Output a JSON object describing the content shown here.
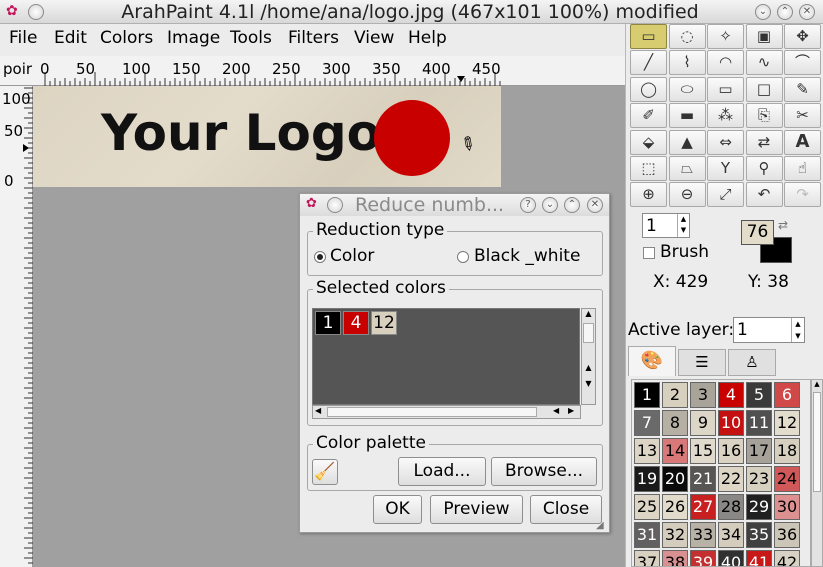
{
  "window": {
    "title": "ArahPaint 4.1l /home/ana/logo.jpg  (467x101  100%) modified"
  },
  "menu": [
    "File",
    "Edit",
    "Colors",
    "Image",
    "Tools",
    "Filters",
    "View",
    "Help"
  ],
  "ruler": {
    "corner_label": "poir",
    "h_ticks": [
      "0",
      "50",
      "100",
      "150",
      "200",
      "250",
      "300",
      "350",
      "400",
      "450"
    ],
    "v_ticks": [
      "100",
      "50",
      "0"
    ]
  },
  "image": {
    "logo_text": "Your Logo",
    "circle_color": "#c80000"
  },
  "dialog": {
    "title": "Reduce numb...",
    "reduction_type": {
      "label": "Reduction type",
      "options": [
        "Color",
        "Black _white"
      ],
      "selected": "Color"
    },
    "selected_colors": {
      "label": "Selected colors",
      "chips": [
        {
          "num": "1",
          "bg": "#000000",
          "fg": "#ffffff"
        },
        {
          "num": "4",
          "bg": "#c80000",
          "fg": "#ffffff"
        },
        {
          "num": "12",
          "bg": "#d8d0be",
          "fg": "#000000"
        }
      ]
    },
    "color_palette": {
      "label": "Color palette",
      "load": "Load...",
      "browse": "Browse..."
    },
    "buttons": {
      "ok": "OK",
      "preview": "Preview",
      "close": "Close"
    }
  },
  "panel": {
    "size_value": "1",
    "brush_label": "Brush",
    "fg_number": "76",
    "x_label": "X: 429",
    "y_label": "Y: 38",
    "active_layer_label": "Active layer:",
    "active_layer_value": "1",
    "palette": [
      {
        "n": "1",
        "bg": "#000000",
        "fg": "#ffffff"
      },
      {
        "n": "2",
        "bg": "#d8d0be",
        "fg": "#000000"
      },
      {
        "n": "3",
        "bg": "#a8a49a",
        "fg": "#000000"
      },
      {
        "n": "4",
        "bg": "#c80000",
        "fg": "#ffffff"
      },
      {
        "n": "5",
        "bg": "#3a3a3a",
        "fg": "#ffffff"
      },
      {
        "n": "6",
        "bg": "#d04848",
        "fg": "#ffffff"
      },
      {
        "n": "7",
        "bg": "#6a6a6a",
        "fg": "#ffffff"
      },
      {
        "n": "8",
        "bg": "#b6b0a4",
        "fg": "#000000"
      },
      {
        "n": "9",
        "bg": "#dcd6c8",
        "fg": "#000000"
      },
      {
        "n": "10",
        "bg": "#c41010",
        "fg": "#ffffff"
      },
      {
        "n": "11",
        "bg": "#505050",
        "fg": "#ffffff"
      },
      {
        "n": "12",
        "bg": "#e2dccd",
        "fg": "#000000"
      },
      {
        "n": "13",
        "bg": "#dcd4c4",
        "fg": "#000000"
      },
      {
        "n": "14",
        "bg": "#d87878",
        "fg": "#000000"
      },
      {
        "n": "15",
        "bg": "#e0dacc",
        "fg": "#000000"
      },
      {
        "n": "16",
        "bg": "#dad2c2",
        "fg": "#000000"
      },
      {
        "n": "17",
        "bg": "#a6a29a",
        "fg": "#000000"
      },
      {
        "n": "18",
        "bg": "#d6cebe",
        "fg": "#000000"
      },
      {
        "n": "19",
        "bg": "#1a1a1a",
        "fg": "#ffffff"
      },
      {
        "n": "20",
        "bg": "#0a0a0a",
        "fg": "#ffffff"
      },
      {
        "n": "21",
        "bg": "#585654",
        "fg": "#ffffff"
      },
      {
        "n": "22",
        "bg": "#ddd6c6",
        "fg": "#000000"
      },
      {
        "n": "23",
        "bg": "#d6d0c0",
        "fg": "#000000"
      },
      {
        "n": "24",
        "bg": "#d05858",
        "fg": "#000000"
      },
      {
        "n": "25",
        "bg": "#dcd5c5",
        "fg": "#000000"
      },
      {
        "n": "26",
        "bg": "#e1dbcc",
        "fg": "#000000"
      },
      {
        "n": "27",
        "bg": "#c82020",
        "fg": "#ffffff"
      },
      {
        "n": "28",
        "bg": "#8a8884",
        "fg": "#000000"
      },
      {
        "n": "29",
        "bg": "#202020",
        "fg": "#ffffff"
      },
      {
        "n": "30",
        "bg": "#dc9090",
        "fg": "#000000"
      },
      {
        "n": "31",
        "bg": "#626060",
        "fg": "#ffffff"
      },
      {
        "n": "32",
        "bg": "#d4ccbc",
        "fg": "#000000"
      },
      {
        "n": "33",
        "bg": "#b8b2a6",
        "fg": "#000000"
      },
      {
        "n": "34",
        "bg": "#d4cdbd",
        "fg": "#000000"
      },
      {
        "n": "35",
        "bg": "#404040",
        "fg": "#ffffff"
      },
      {
        "n": "36",
        "bg": "#ccc6b8",
        "fg": "#000000"
      },
      {
        "n": "37",
        "bg": "#d8d0c0",
        "fg": "#000000"
      },
      {
        "n": "38",
        "bg": "#d89090",
        "fg": "#000000"
      },
      {
        "n": "39",
        "bg": "#c43030",
        "fg": "#ffffff"
      },
      {
        "n": "40",
        "bg": "#303030",
        "fg": "#ffffff"
      },
      {
        "n": "41",
        "bg": "#c81818",
        "fg": "#ffffff"
      },
      {
        "n": "42",
        "bg": "#d8d2c4",
        "fg": "#000000"
      }
    ]
  },
  "tools": [
    "rect-select-icon",
    "lasso-icon",
    "magic-wand-icon",
    "crop-icon",
    "move-icon",
    "line-icon",
    "polyline-icon",
    "arc-icon",
    "bezier-icon",
    "curve-icon",
    "ellipse-icon",
    "ellipse-fill-icon",
    "rectangle-icon",
    "rectangle-fill-icon",
    "pencil-icon",
    "brush-icon",
    "eraser-icon",
    "spray-icon",
    "clone-icon",
    "scissors-icon",
    "bucket-icon",
    "gradient-icon",
    "flip-icon",
    "selection-move-icon",
    "text-icon",
    "transform-icon",
    "perspective-icon",
    "warp-icon",
    "symmetry-icon",
    "smudge-icon",
    "zoom-in-icon",
    "zoom-out-icon",
    "fit-icon",
    "undo-icon",
    "redo-icon"
  ]
}
